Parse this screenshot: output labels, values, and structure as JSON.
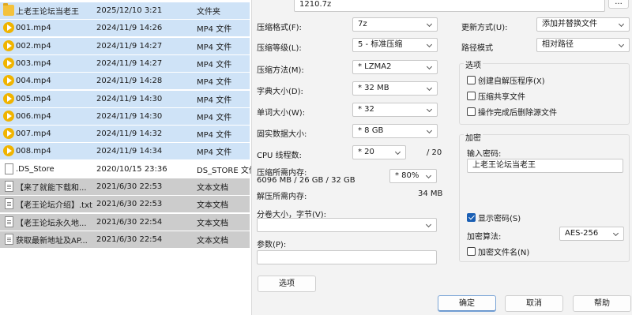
{
  "explorer": {
    "rows": [
      {
        "name": "上老王论坛当老王",
        "date": "2025/12/10 3:21",
        "type": "文件夹",
        "icon": "folder-icon",
        "kind": "folder"
      },
      {
        "name": "001.mp4",
        "date": "2024/11/9 14:26",
        "type": "MP4 文件",
        "icon": "video-icon",
        "kind": "mp4"
      },
      {
        "name": "002.mp4",
        "date": "2024/11/9 14:27",
        "type": "MP4 文件",
        "icon": "video-icon",
        "kind": "mp4"
      },
      {
        "name": "003.mp4",
        "date": "2024/11/9 14:27",
        "type": "MP4 文件",
        "icon": "video-icon",
        "kind": "mp4"
      },
      {
        "name": "004.mp4",
        "date": "2024/11/9 14:28",
        "type": "MP4 文件",
        "icon": "video-icon",
        "kind": "mp4"
      },
      {
        "name": "005.mp4",
        "date": "2024/11/9 14:30",
        "type": "MP4 文件",
        "icon": "video-icon",
        "kind": "mp4"
      },
      {
        "name": "006.mp4",
        "date": "2024/11/9 14:30",
        "type": "MP4 文件",
        "icon": "video-icon",
        "kind": "mp4"
      },
      {
        "name": "007.mp4",
        "date": "2024/11/9 14:32",
        "type": "MP4 文件",
        "icon": "video-icon",
        "kind": "mp4"
      },
      {
        "name": "008.mp4",
        "date": "2024/11/9 14:34",
        "type": "MP4 文件",
        "icon": "video-icon",
        "kind": "mp4"
      },
      {
        "name": ".DS_Store",
        "date": "2020/10/15 23:36",
        "type": "DS_STORE 文件",
        "icon": "file-icon",
        "kind": "plain"
      },
      {
        "name": "【来了就能下载和...",
        "date": "2021/6/30 22:53",
        "type": "文本文档",
        "icon": "text-document-icon",
        "kind": "txt"
      },
      {
        "name": "【老王论坛介绍】.txt",
        "date": "2021/6/30 22:53",
        "type": "文本文档",
        "icon": "text-document-icon",
        "kind": "txt"
      },
      {
        "name": "【老王论坛永久地...",
        "date": "2021/6/30 22:54",
        "type": "文本文档",
        "icon": "text-document-icon",
        "kind": "txt"
      },
      {
        "name": "获取最新地址及AP...",
        "date": "2021/6/30 22:54",
        "type": "文本文档",
        "icon": "text-document-icon",
        "kind": "txt"
      }
    ]
  },
  "dialog": {
    "archive_path": "1210.7z",
    "browse_label": "...",
    "format_label": "压缩格式(F):",
    "format_value": "7z",
    "level_label": "压缩等级(L):",
    "level_value": "5 - 标准压缩",
    "method_label": "压缩方法(M):",
    "method_value": "* LZMA2",
    "dict_label": "字典大小(D):",
    "dict_value": "* 32 MB",
    "word_label": "单词大小(W):",
    "word_value": "* 32",
    "solid_label": "固实数据大小:",
    "solid_value": "* 8 GB",
    "threads_label": "CPU 线程数:",
    "threads_value": "* 20",
    "threads_total": "/ 20",
    "mem_label": "压缩所需内存:",
    "mem_value": "6096 MB / 26 GB / 32 GB",
    "mem_percent": "* 80%",
    "decomp_label": "解压所需内存:",
    "decomp_value": "34 MB",
    "split_label": "分卷大小，字节(V):",
    "split_value": "",
    "params_label": "参数(P):",
    "params_value": "",
    "options_button": "选项",
    "update_label": "更新方式(U):",
    "update_value": "添加并替换文件",
    "pathmode_label": "路径模式",
    "pathmode_value": "相对路径",
    "options_group": "选项",
    "opt_sfx": "创建自解压程序(X)",
    "opt_shared": "压缩共享文件",
    "opt_delete": "操作完成后删除源文件",
    "encrypt_group": "加密",
    "password_label": "输入密码:",
    "password_value": "上老王论坛当老王",
    "show_password": "显示密码(S)",
    "encrypt_method_label": "加密算法:",
    "encrypt_method_value": "AES-256",
    "encrypt_names": "加密文件名(N)",
    "ok_button": "确定",
    "cancel_button": "取消",
    "help_button": "帮助"
  }
}
